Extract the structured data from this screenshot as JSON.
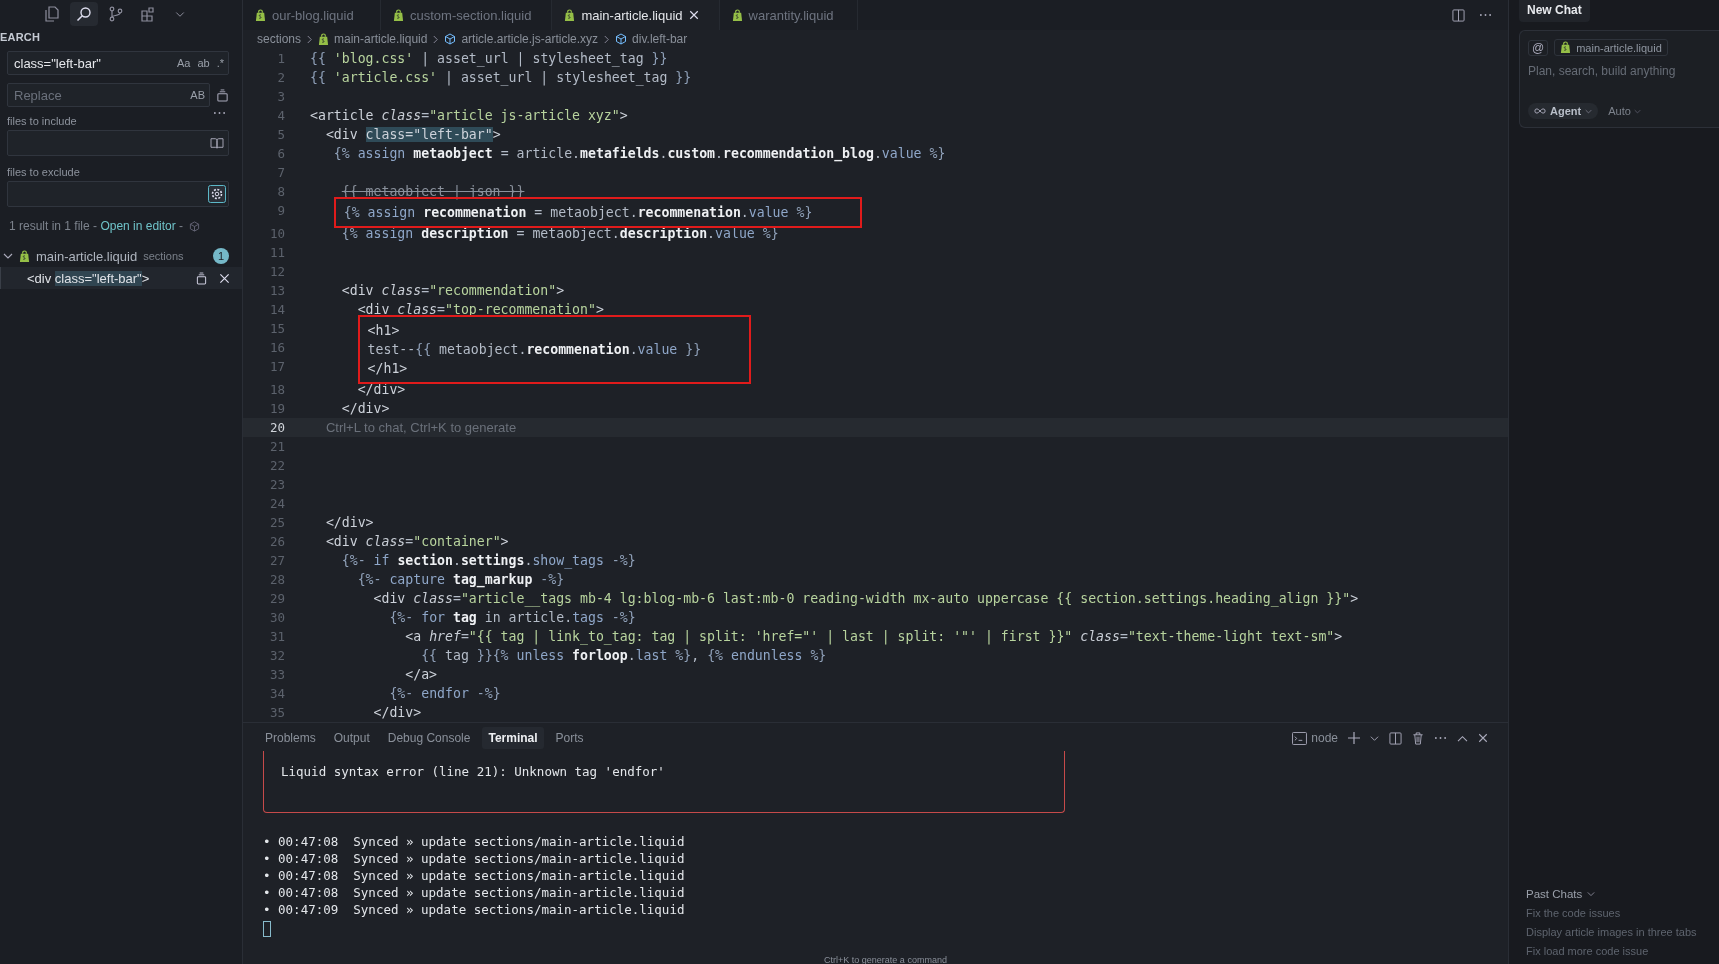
{
  "activity_bar": [
    {
      "kind": "files",
      "selected": false
    },
    {
      "kind": "search",
      "selected": true
    },
    {
      "kind": "branch",
      "selected": false
    },
    {
      "kind": "blocks",
      "selected": false
    },
    {
      "kind": "chevron",
      "selected": false
    }
  ],
  "search_panel": {
    "title": "EARCH",
    "query": "class=\"left-bar\"",
    "query_options": [
      "Aa",
      "ab",
      ".*"
    ],
    "replace_placeholder": "Replace",
    "replace_option": "AB",
    "include_label": "files to include",
    "exclude_label": "files to exclude",
    "summary": "1 result in 1 file - ",
    "open_link": "Open in editor",
    "summary_sep": " - ",
    "result_file": {
      "name": "main-article.liquid",
      "folder": "sections",
      "count": "1",
      "expanded": true
    },
    "result_match": {
      "pre": "<div ",
      "match": "class=\"left-bar\"",
      "post": ">"
    }
  },
  "tabs": [
    {
      "label": "our-blog.liquid",
      "selected": false
    },
    {
      "label": "custom-section.liquid",
      "selected": false
    },
    {
      "label": "main-article.liquid",
      "selected": true
    },
    {
      "label": "warantity.liquid",
      "selected": false
    }
  ],
  "breadcrumb": [
    {
      "kind": "folder",
      "text": "sections"
    },
    {
      "kind": "file",
      "text": "main-article.liquid"
    },
    {
      "kind": "element",
      "text": "article.article.js-article.xyz"
    },
    {
      "kind": "element",
      "text": "div.left-bar"
    }
  ],
  "code": [
    {
      "kind": "plain",
      "lines": [
        {
          "number": "1",
          "current": false,
          "kind": "code",
          "text": "{{ 'blog.css' | asset_url | stylesheet_tag }}"
        },
        {
          "number": "2",
          "current": false,
          "kind": "code",
          "text": "{{ 'article.css' | asset_url | stylesheet_tag }}"
        },
        {
          "number": "3",
          "current": false,
          "kind": "empty"
        },
        {
          "number": "4",
          "current": false,
          "kind": "code",
          "text": "<article class=\"article js-article xyz\">"
        },
        {
          "number": "5",
          "current": false,
          "kind": "code",
          "text": "  <div class=\"left-bar\">"
        },
        {
          "number": "6",
          "current": false,
          "kind": "code",
          "text": "   {% assign metaobject = article.metafields.custom.recommendation_blog.value %}"
        },
        {
          "number": "7",
          "current": false,
          "kind": "empty"
        },
        {
          "number": "8",
          "current": false,
          "kind": "struck",
          "text": "    {{ metaobject | json }}"
        }
      ]
    },
    {
      "kind": "annotated",
      "lines": [
        {
          "number": "9",
          "current": false,
          "kind": "code",
          "text": "    {% assign recommenation = metaobject.recommenation.value %}"
        }
      ]
    },
    {
      "kind": "plain",
      "lines": [
        {
          "number": "10",
          "current": false,
          "kind": "code",
          "text": "    {% assign description = metaobject.description.value %}"
        },
        {
          "number": "11",
          "current": false,
          "kind": "empty"
        },
        {
          "number": "12",
          "current": false,
          "kind": "empty"
        },
        {
          "number": "13",
          "current": false,
          "kind": "code",
          "text": "    <div class=\"recommendation\">"
        },
        {
          "number": "14",
          "current": false,
          "kind": "code",
          "text": "      <div class=\"top-recommenation\">"
        }
      ]
    },
    {
      "kind": "annotated",
      "lines": [
        {
          "number": "15",
          "current": false,
          "kind": "code",
          "text": "       <h1>"
        },
        {
          "number": "16",
          "current": false,
          "kind": "code",
          "text": "       test--{{ metaobject.recommenation.value }}"
        },
        {
          "number": "17",
          "current": false,
          "kind": "code",
          "text": "       </h1>"
        }
      ]
    },
    {
      "kind": "plain",
      "lines": [
        {
          "number": "18",
          "current": false,
          "kind": "code",
          "text": "      </div>"
        },
        {
          "number": "19",
          "current": false,
          "kind": "code",
          "text": "    </div>"
        },
        {
          "number": "20",
          "current": true,
          "kind": "hint",
          "text": "  Ctrl+L to chat, Ctrl+K to generate"
        },
        {
          "number": "21",
          "current": false,
          "kind": "empty"
        },
        {
          "number": "22",
          "current": false,
          "kind": "empty"
        },
        {
          "number": "23",
          "current": false,
          "kind": "empty"
        },
        {
          "number": "24",
          "current": false,
          "kind": "empty"
        },
        {
          "number": "25",
          "current": false,
          "kind": "code",
          "text": "  </div>"
        },
        {
          "number": "26",
          "current": false,
          "kind": "code",
          "text": "  <div class=\"container\">"
        },
        {
          "number": "27",
          "current": false,
          "kind": "code",
          "text": "    {%- if section.settings.show_tags -%}"
        },
        {
          "number": "28",
          "current": false,
          "kind": "code",
          "text": "      {%- capture tag_markup -%}"
        },
        {
          "number": "29",
          "current": false,
          "kind": "code",
          "text": "        <div class=\"article__tags mb-4 lg:blog-mb-6 last:mb-0 reading-width mx-auto uppercase {{ section.settings.heading_align }}\">"
        },
        {
          "number": "30",
          "current": false,
          "kind": "code",
          "text": "          {%- for tag in article.tags -%}"
        },
        {
          "number": "31",
          "current": false,
          "kind": "code",
          "text": "            <a href=\"{{ tag | link_to_tag: tag | split: 'href=\"' | last | split: '\"' | first }}\" class=\"text-theme-light text-sm\">"
        },
        {
          "number": "32",
          "current": false,
          "kind": "code",
          "text": "              {{ tag }}{% unless forloop.last %}, {% endunless %}"
        },
        {
          "number": "33",
          "current": false,
          "kind": "code",
          "text": "            </a>"
        },
        {
          "number": "34",
          "current": false,
          "kind": "code",
          "text": "          {%- endfor -%}"
        },
        {
          "number": "35",
          "current": false,
          "kind": "code",
          "text": "        </div>"
        }
      ]
    }
  ],
  "panel": {
    "tabs": [
      {
        "label": "Problems",
        "selected": false
      },
      {
        "label": "Output",
        "selected": false
      },
      {
        "label": "Debug Console",
        "selected": false
      },
      {
        "label": "Terminal",
        "selected": true
      },
      {
        "label": "Ports",
        "selected": false
      }
    ],
    "shell": "node",
    "error": "Liquid syntax error (line 21): Unknown tag 'endfor'",
    "log": [
      "• 00:47:08  Synced » update sections/main-article.liquid",
      "• 00:47:08  Synced » update sections/main-article.liquid",
      "• 00:47:08  Synced » update sections/main-article.liquid",
      "• 00:47:08  Synced » update sections/main-article.liquid",
      "• 00:47:09  Synced » update sections/main-article.liquid"
    ],
    "hint": "Ctrl+K to generate a command"
  },
  "chat": {
    "tab": "New Chat",
    "mention": "@",
    "context_file": "main-article.liquid",
    "placeholder": "Plan, search, build anything",
    "mode": "Agent",
    "model": "Auto",
    "past_title": "Past Chats",
    "past": [
      "Fix the code issues",
      "Display article images in three tabs",
      "Fix load more code issue"
    ]
  }
}
